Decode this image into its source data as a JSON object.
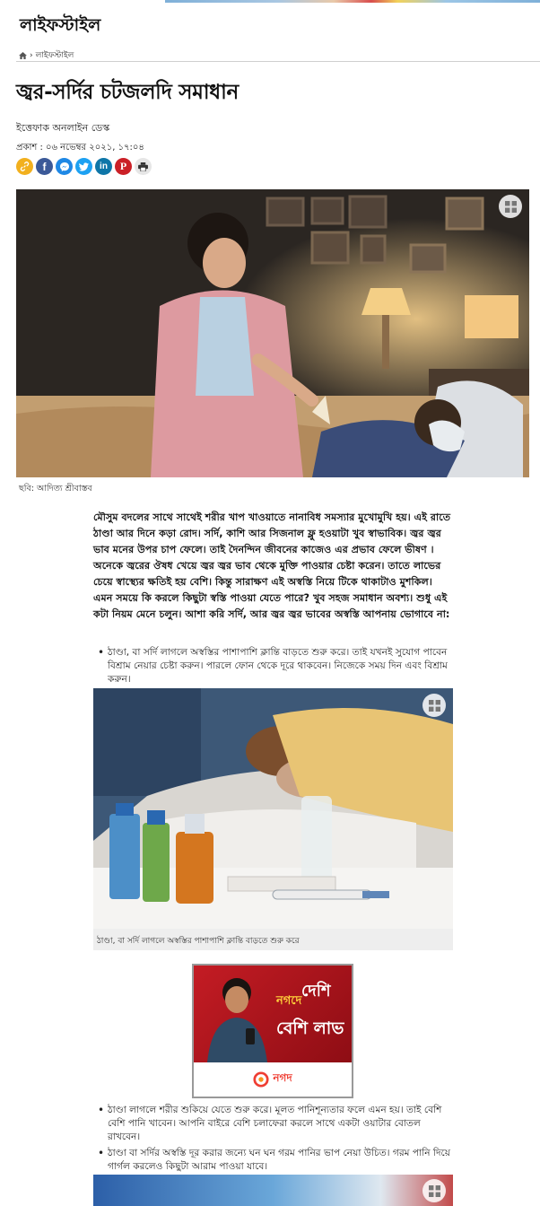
{
  "header": {
    "section_title": "লাইফস্টাইল",
    "breadcrumb": {
      "separator": "›",
      "current": "লাইফস্টাইল"
    }
  },
  "article": {
    "headline": "জ্বর-সর্দির চটজলদি সমাধান",
    "author": "ইত্তেফাক অনলাইন ডেস্ক",
    "published": "প্রকাশ : ০৬ নভেম্বর ২০২১, ১৭:০৪",
    "hero_caption": "ছবি: আদিত্য শ্রীবাস্তব",
    "lead": "মৌসুম বদলের সাথে সাথেই শরীর খাপ খাওয়াতে নানাবিধ সমস্যার মুখোমুখি হয়। এই রাতে ঠাণ্ডা আর দিনে কড়া রোদ। সর্দি, কাশি আর সিজনাল ফ্লু হওয়াটা খুব স্বাভাবিক। জ্বর জ্বর ভাব মনের উপর চাপ ফেলে। তাই দৈনন্দিন জীবনের কাজেও এর প্রভাব ফেলে ভীষণ । অনেকে জ্বরের ঔষধ খেয়ে জ্বর জ্বর ভাব থেকে মুক্তি পাওয়ার চেষ্টা করেন। তাতে লাভের চেয়ে স্বাস্থ্যের ক্ষতিই হয় বেশি। কিন্তু সারাক্ষণ এই অস্বস্তি নিয়ে টিকে থাকাটাও মুশকিল। এমন সময়ে কি করলে কিছুটা স্বস্তি পাওয়া যেতে পারে? খুব সহজ সমাধান অবশ্য। শুধু এই কটা নিয়ম মেনে চলুন। আশা করি সর্দি, আর জ্বর জ্বর ভাবের অস্বস্তি আপনায় ভোগাবে না:",
    "bullets": [
      "ঠাণ্ডা, বা সর্দি লাগলে অস্বস্তির পাশাপাশি ক্লান্তি বাড়তে শুরু করে। তাই যখনই সুযোগ পাবেন বিশ্রাম নেয়ার চেষ্টা করুন। পারলে ফোন থেকে দূরে থাকবেন। নিজেকে সময় দিন এবং  বিশ্রাম করুন।",
      "ঠাণ্ডা লাগলে শরীর শুকিয়ে যেতে শুরু করে। মূলত পানিশূন্যতার ফলে এমন হয়। তাই বেশি বেশি পানি খাবেন। আপনি বাইরে বেশি চলাফেরা করলে সাথে একটা ওয়াটার বোতল রাখবেন।",
      "ঠাণ্ডা বা সর্দির অস্বস্তি দূর করার জন্যে ঘন ঘন গরম পানির ভাপ নেয়া উচিত। গরম পানি দিয়ে গার্গল করলেও কিছুটা আরাম পাওয়া যাবে।"
    ],
    "image2_caption": "ঠাণ্ডা, বা সর্দি লাগলে অস্বস্তির পাশাপাশি ক্লান্তি বাড়তে শুরু করে"
  },
  "share": {
    "buttons": [
      {
        "name": "link",
        "color": "#f2b01e"
      },
      {
        "name": "facebook",
        "color": "#3b5998"
      },
      {
        "name": "messenger",
        "color": "#1e88e5"
      },
      {
        "name": "twitter",
        "color": "#1da1f2"
      },
      {
        "name": "linkedin",
        "color": "#0e76a8"
      },
      {
        "name": "pinterest",
        "color": "#cb2027"
      },
      {
        "name": "print",
        "color": "#e6e6e6"
      }
    ]
  },
  "ad": {
    "headline_line1": "দেশি",
    "headline_line2": "নগদে",
    "headline_line3": "বেশি লাভ",
    "brand": "নগদ"
  }
}
